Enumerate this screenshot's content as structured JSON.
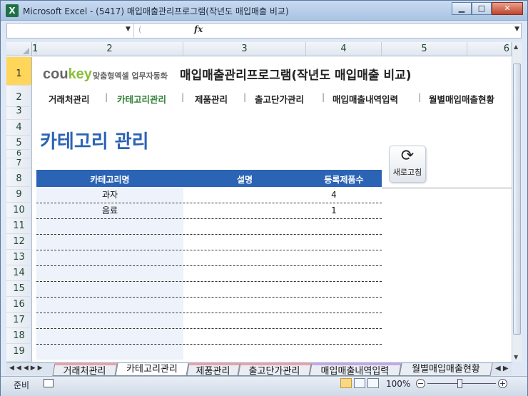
{
  "window": {
    "title": "Microsoft Excel - (5417) 매입매출관리프로그램(작년도 매입매출 비교)",
    "app_icon": "X"
  },
  "formula_bar": {
    "name_box": "",
    "fx": "fx",
    "content": ""
  },
  "columns": [
    "1",
    "2",
    "3",
    "4",
    "5",
    "6"
  ],
  "rows": [
    "1",
    "2",
    "3",
    "4",
    "5",
    "6",
    "7",
    "8",
    "9",
    "10",
    "11",
    "12",
    "13",
    "14",
    "15",
    "16",
    "17",
    "18",
    "19"
  ],
  "sheet": {
    "logo_main": "cou",
    "logo_accent": "key",
    "logo_sub": "맞춤형엑셀 업무자동화",
    "app_title": "매입매출관리프로그램(작년도 매입매출 비교)",
    "nav": [
      "거래처관리",
      "카테고리관리",
      "제품관리",
      "출고단가관리",
      "매입매출내역입력",
      "월별매입매출현황"
    ],
    "nav_separator": "|",
    "active_nav": "카테고리관리",
    "page_title": "카테고리 관리",
    "refresh": {
      "icon": "refresh-icon",
      "label": "새로고침"
    },
    "table": {
      "headers": [
        "카테고리명",
        "설명",
        "등록제품수"
      ],
      "rows": [
        {
          "name": "과자",
          "desc": "",
          "count": "4"
        },
        {
          "name": "음료",
          "desc": "",
          "count": "1"
        },
        {
          "name": "",
          "desc": "",
          "count": ""
        },
        {
          "name": "",
          "desc": "",
          "count": ""
        },
        {
          "name": "",
          "desc": "",
          "count": ""
        },
        {
          "name": "",
          "desc": "",
          "count": ""
        },
        {
          "name": "",
          "desc": "",
          "count": ""
        },
        {
          "name": "",
          "desc": "",
          "count": ""
        },
        {
          "name": "",
          "desc": "",
          "count": ""
        },
        {
          "name": "",
          "desc": "",
          "count": ""
        },
        {
          "name": "",
          "desc": "",
          "count": ""
        }
      ]
    }
  },
  "sheet_tabs": [
    "거래처관리",
    "카테고리관리",
    "제품관리",
    "출고단가관리",
    "매입매출내역입력",
    "월별매입매출현황"
  ],
  "status": {
    "ready": "준비",
    "zoom": "100%"
  },
  "colors": {
    "accent_blue": "#2b63b5",
    "active_green": "#2e7d32",
    "selected_row": "#ffd65a"
  }
}
